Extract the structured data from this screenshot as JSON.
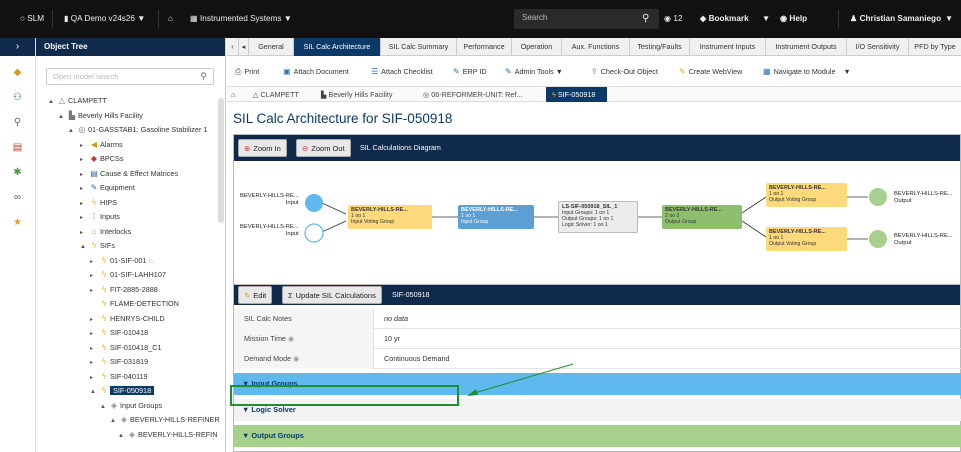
{
  "topbar": {
    "app": "SLM",
    "demo": "QA Demo v24s26",
    "section": "Instrumented Systems",
    "search_placeholder": "Search",
    "count": "12",
    "bookmark": "Bookmark",
    "help": "Help",
    "user": "Christian Samaniego"
  },
  "leftnav": {
    "toggle": "›"
  },
  "tree": {
    "header": "Object Tree",
    "search_placeholder": "Open model search",
    "nodes": [
      {
        "label": "CLAMPETT",
        "icon": "building-outline-icon"
      },
      {
        "label": "Beverly Hills Facility",
        "icon": "facility-icon"
      },
      {
        "label": "01-GASSTAB1: Gasoline Stabilizer 1",
        "icon": "unit-icon"
      },
      {
        "label": "Alarms",
        "icon": "alarm-icon"
      },
      {
        "label": "BPCSs",
        "icon": "bpcs-icon"
      },
      {
        "label": "Cause & Effect Matrices",
        "icon": "matrix-icon"
      },
      {
        "label": "Equipment",
        "icon": "equipment-icon"
      },
      {
        "label": "HIPS",
        "icon": "lightning-icon"
      },
      {
        "label": "Inputs",
        "icon": "inputs-icon"
      },
      {
        "label": "Interlocks",
        "icon": "lock-icon"
      },
      {
        "label": "SIFs",
        "icon": "lightning-icon"
      },
      {
        "label": "01-SIF-001",
        "icon": "lightning-icon"
      },
      {
        "label": "01-SIF-LAHH107",
        "icon": "lightning-icon"
      },
      {
        "label": "FIT-2885-2888",
        "icon": "lightning-icon"
      },
      {
        "label": "FLAME-DETECTION",
        "icon": "lightning-icon"
      },
      {
        "label": "HENRYS-CHILD",
        "icon": "lightning-icon"
      },
      {
        "label": "SIF-010418",
        "icon": "lightning-icon"
      },
      {
        "label": "SIF-010418_C1",
        "icon": "lightning-icon"
      },
      {
        "label": "SIF-031819",
        "icon": "lightning-icon"
      },
      {
        "label": "SIF-040119",
        "icon": "lightning-icon"
      },
      {
        "label": "SIF-050918",
        "icon": "lightning-icon"
      },
      {
        "label": "Input Groups",
        "icon": "group-icon"
      },
      {
        "label": "BEVERLY-HILLS-REFINER",
        "icon": "group-icon"
      },
      {
        "label": "BEVERLY-HILLS-REFIN",
        "icon": "group-icon"
      }
    ]
  },
  "tabs": [
    "General",
    "SIL Calc Architecture",
    "SIL Calc Summary",
    "Performance",
    "Operation",
    "Aux. Functions",
    "Testing/Faults",
    "Instrument Inputs",
    "Instrument Outputs",
    "I/O Sensitivity",
    "PFD by Type"
  ],
  "toolbar": {
    "print": "Print",
    "attach_doc": "Attach Document",
    "attach_check": "Attach Checklist",
    "erp": "ERP ID",
    "admin": "Admin Tools",
    "checkout": "Check-Out Object",
    "webview": "Create WebView",
    "navigate": "Navigate to Module"
  },
  "breadcrumb": [
    "CLAMPETT",
    "Beverly Hills Facility",
    "06-REFORMER-UNIT: Ref...",
    "SIF-050918"
  ],
  "page_title": "SIL Calc Architecture for SIF-050918",
  "diagram": {
    "zoom_in": "Zoom In",
    "zoom_out": "Zoom Out",
    "title": "SIL Calculations Diagram",
    "in1_name": "BEVERLY-HILLS-RE...",
    "in1_sub": "Input",
    "in2_name": "BEVERLY-HILLS-RE...",
    "in2_sub": "Input",
    "ivg_name": "BEVERLY-HILLS-RE...",
    "ivg_l1": "1 oo 1",
    "ivg_l2": "Input Voting Group",
    "ig_name": "BEVERLY-HILLS-RE...",
    "ig_l1": "1 oo 1",
    "ig_l2": "Input Group",
    "ls_name": "LS-SIF-050918_SIL_1",
    "ls_l1": "Input Groups: 1 oo 1",
    "ls_l2": "Output Groups: 1 oo 1",
    "ls_l3": "Logic Solver: 1 oo 1",
    "og_name": "BEVERLY-HILLS-RE...",
    "og_l1": "2 oo 2",
    "og_l2": "Output Group",
    "ovg1_name": "BEVERLY-HILLS-RE...",
    "ovg1_l1": "1 oo 1",
    "ovg1_l2": "Output Voting Group",
    "ovg2_name": "BEVERLY-HILLS-RE...",
    "ovg2_l1": "1 oo 1",
    "ovg2_l2": "Output Voting Group",
    "out1_name": "BEVERLY-HILLS-RE...",
    "out1_sub": "Output",
    "out2_name": "BEVERLY-HILLS-RE...",
    "out2_sub": "Output"
  },
  "details": {
    "edit": "Edit",
    "update": "Update SIL Calculations",
    "title": "SIF-050918",
    "rows": [
      {
        "k": "SIL Calc Notes",
        "v": "no data"
      },
      {
        "k": "Mission Time",
        "v": "10 yr"
      },
      {
        "k": "Demand Mode",
        "v": "Continuous Demand"
      }
    ],
    "sections": [
      "Input Groups",
      "Logic Solver",
      "Output Groups"
    ]
  },
  "colors": {
    "navy": "#102a4c",
    "selected": "#0b3a69",
    "input_groups": "#5fb8ee",
    "output_groups": "#a8d08d",
    "highlight": "#1e8f2e"
  }
}
